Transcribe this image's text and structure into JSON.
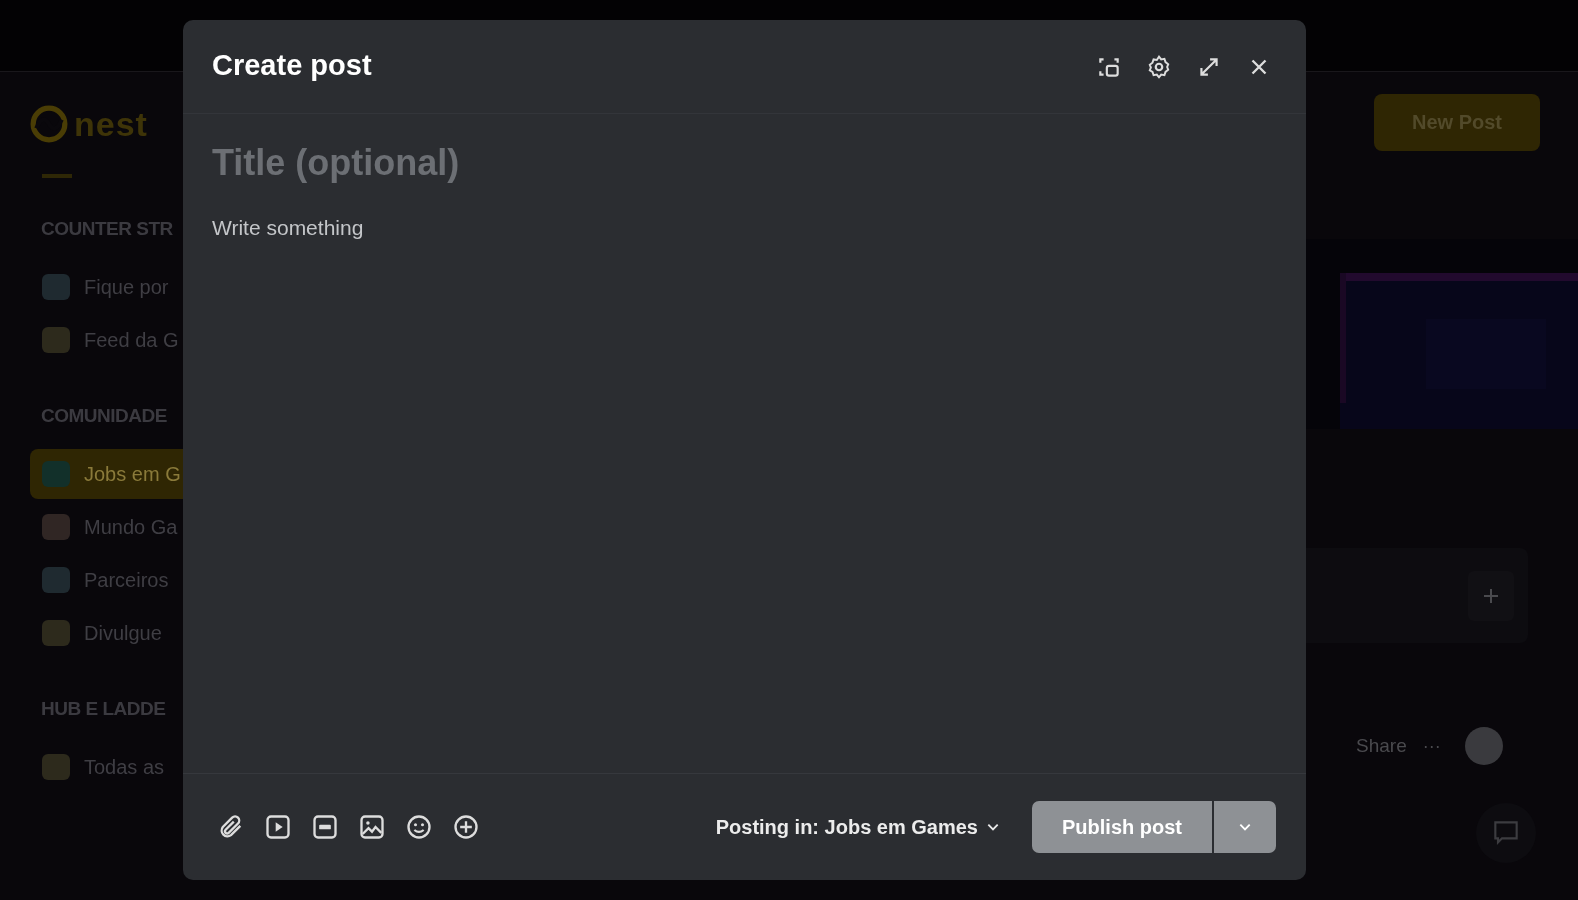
{
  "header": {
    "logo": "nest"
  },
  "sidebar": {
    "sections": [
      {
        "heading": "COUNTER STR",
        "items": [
          {
            "label": "Fique por",
            "selected": false
          },
          {
            "label": "Feed da G",
            "selected": false
          }
        ]
      },
      {
        "heading": "COMUNIDADE",
        "items": [
          {
            "label": "Jobs em G",
            "selected": true
          },
          {
            "label": "Mundo Ga",
            "selected": false
          },
          {
            "label": "Parceiros",
            "selected": false
          },
          {
            "label": "Divulgue",
            "selected": false
          }
        ]
      },
      {
        "heading": "HUB E LADDE",
        "items": [
          {
            "label": "Todas as",
            "selected": false
          }
        ]
      }
    ]
  },
  "new_post_button": "New Post",
  "post_actions": {
    "share": "Share",
    "more": "···"
  },
  "dialog": {
    "title": "Create post",
    "title_field": {
      "placeholder": "Title (optional)"
    },
    "body_field": {
      "placeholder": "Write something"
    },
    "posting_in": "Posting in: Jobs em Games",
    "publish_button": {
      "label": "Publish post",
      "disabled": true
    }
  }
}
